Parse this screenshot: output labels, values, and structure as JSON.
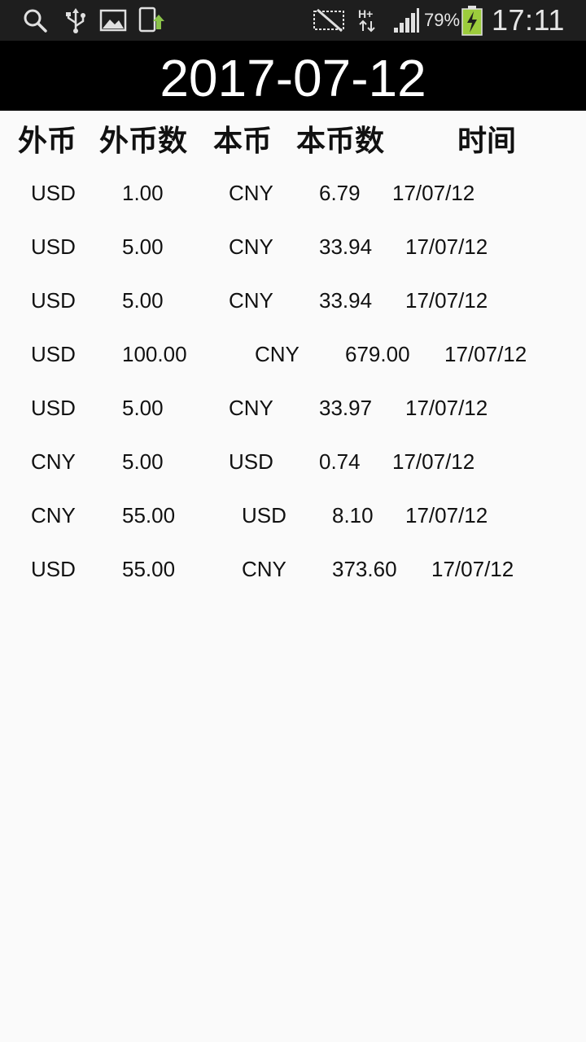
{
  "status_bar": {
    "battery_percent": "79%",
    "clock": "17:11",
    "icons": [
      "search-icon",
      "usb-icon",
      "image-icon",
      "phone-sync-icon",
      "signal-muted-icon",
      "h-plus-data-icon",
      "cell-signal-icon",
      "battery-charging-icon"
    ]
  },
  "title": "2017-07-12",
  "header": {
    "foreign_currency": "外币",
    "foreign_amount": "外币数",
    "local_currency": "本币",
    "local_amount": "本币数",
    "time": "时间"
  },
  "rows": [
    {
      "from": "USD",
      "from_amount": "1.00",
      "to": "CNY",
      "to_amount": "6.79",
      "date": "17/07/12"
    },
    {
      "from": "USD",
      "from_amount": "5.00",
      "to": "CNY",
      "to_amount": "33.94",
      "date": "17/07/12"
    },
    {
      "from": "USD",
      "from_amount": "5.00",
      "to": "CNY",
      "to_amount": "33.94",
      "date": "17/07/12"
    },
    {
      "from": "USD",
      "from_amount": "100.00",
      "to": "CNY",
      "to_amount": "679.00",
      "date": "17/07/12"
    },
    {
      "from": "USD",
      "from_amount": "5.00",
      "to": "CNY",
      "to_amount": "33.97",
      "date": "17/07/12"
    },
    {
      "from": "CNY",
      "from_amount": "5.00",
      "to": "USD",
      "to_amount": "0.74",
      "date": "17/07/12"
    },
    {
      "from": "CNY",
      "from_amount": "55.00",
      "to": "USD",
      "to_amount": "8.10",
      "date": "17/07/12"
    },
    {
      "from": "USD",
      "from_amount": "55.00",
      "to": "CNY",
      "to_amount": "373.60",
      "date": "17/07/12"
    }
  ]
}
